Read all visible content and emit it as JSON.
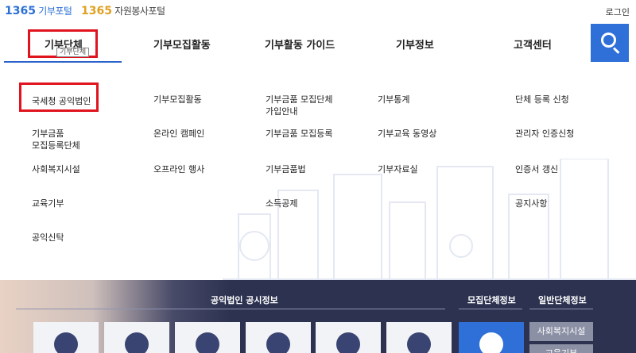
{
  "header": {
    "logo_donation_num": "1365",
    "logo_donation_text": "기부포털",
    "logo_volunteer_num": "1365",
    "logo_volunteer_text": "자원봉사포털",
    "login_label": "로그인"
  },
  "gnb": {
    "items": [
      "기부단체",
      "기부모집활동",
      "기부활동 가이드",
      "기부정보",
      "고객센터"
    ],
    "tooltip": "기부단체",
    "search_icon": "search-icon"
  },
  "mega_menu": {
    "col1": [
      "국세청 공익법인",
      "기부금품\n모집등록단체",
      "사회복지시설",
      "교육기부",
      "공익신탁"
    ],
    "col2": [
      "기부모집활동",
      "온라인 캠페인",
      "오프라인 행사"
    ],
    "col3": [
      "기부금품 모집단체\n가입안내",
      "기부금품 모집등록",
      "기부금품법",
      "소득공제"
    ],
    "col4": [
      "기부통계",
      "기부교육 동영상",
      "기부자료실"
    ],
    "col5": [
      "단체 등록 신청",
      "관리자 인증신청",
      "인증서 갱신",
      "공지사항"
    ]
  },
  "bottom": {
    "public_info_title": "공익법인 공시정보",
    "recruit_info_title": "모집단체정보",
    "general_info_title": "일반단체정보",
    "side_buttons": [
      "사회복지시설",
      "교육기부"
    ],
    "tile_icons": [
      "books-icon",
      "graduation-cap-icon",
      "hands-heart-icon",
      "medical-icon",
      "people-icon",
      "donate-icon",
      "heart-hand-icon"
    ]
  },
  "colors": {
    "accent": "#2e6fd8",
    "highlight_box": "#e0141e",
    "bottom_bg": "#2c3250"
  }
}
